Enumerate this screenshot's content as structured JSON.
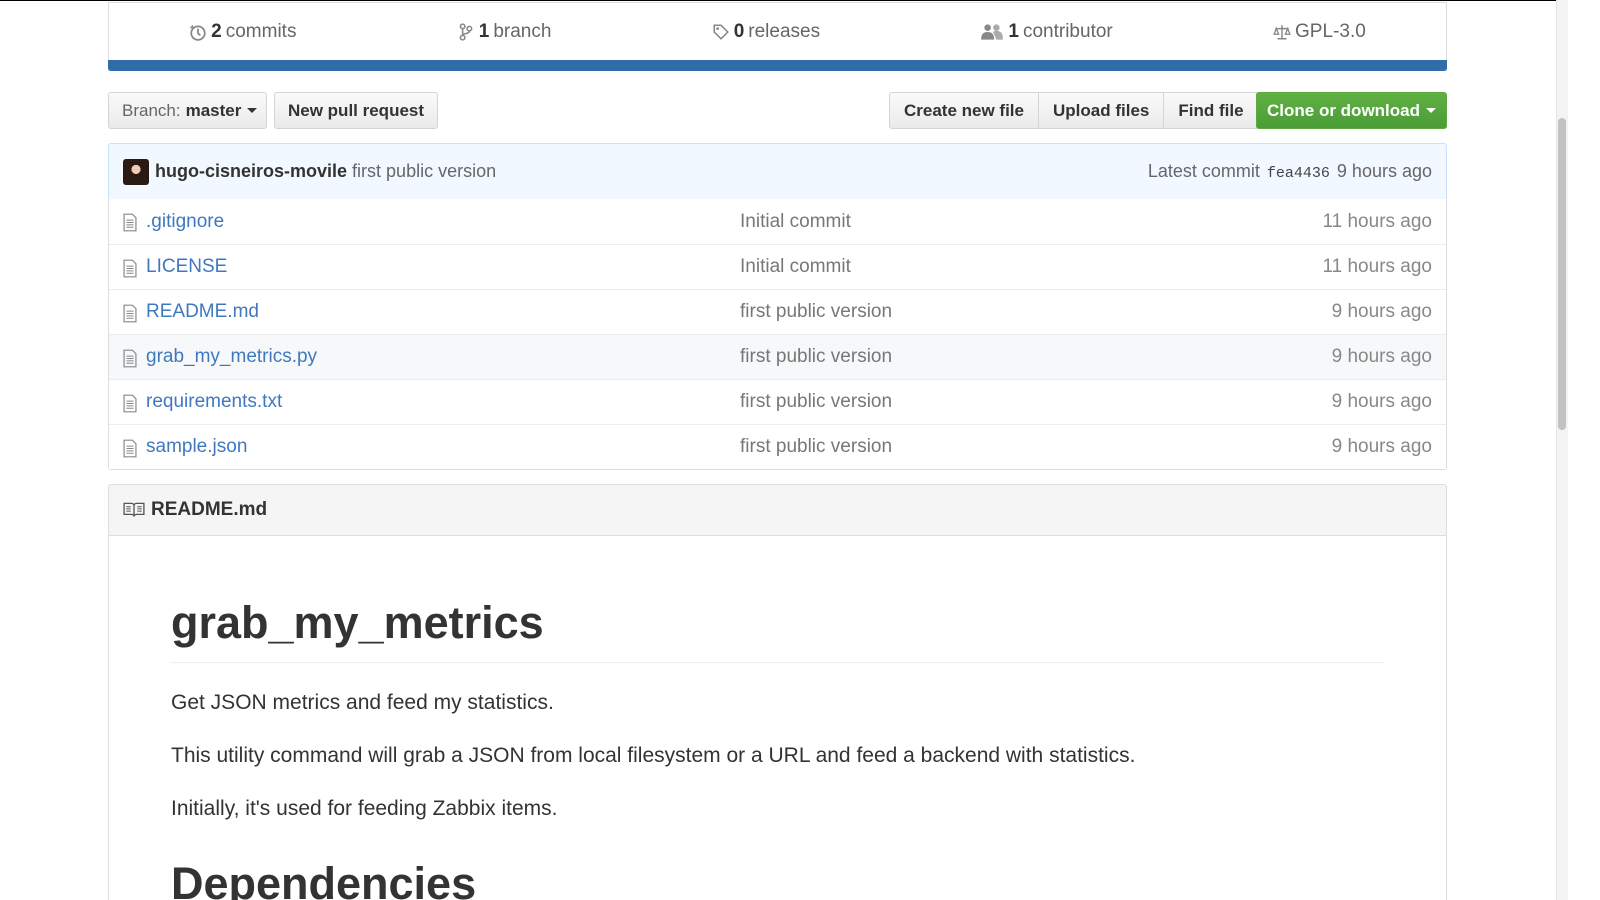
{
  "summary": {
    "commits": {
      "count": "2",
      "label": "commits"
    },
    "branches": {
      "count": "1",
      "label": "branch"
    },
    "releases": {
      "count": "0",
      "label": "releases"
    },
    "contributors": {
      "count": "1",
      "label": "contributor"
    },
    "license": "GPL-3.0"
  },
  "file_nav": {
    "branch_label": "Branch:",
    "branch_value": "master",
    "new_pull_request": "New pull request",
    "create_new_file": "Create new file",
    "upload_files": "Upload files",
    "find_file": "Find file",
    "clone_or_download": "Clone or download"
  },
  "commit_tease": {
    "author": "hugo-cisneiros-movile",
    "message": "first public version",
    "latest_label": "Latest commit",
    "sha": "fea4436",
    "age": "9 hours ago"
  },
  "files": [
    {
      "name": ".gitignore",
      "message": "Initial commit",
      "age": "11 hours ago"
    },
    {
      "name": "LICENSE",
      "message": "Initial commit",
      "age": "11 hours ago"
    },
    {
      "name": "README.md",
      "message": "first public version",
      "age": "9 hours ago"
    },
    {
      "name": "grab_my_metrics.py",
      "message": "first public version",
      "age": "9 hours ago"
    },
    {
      "name": "requirements.txt",
      "message": "first public version",
      "age": "9 hours ago"
    },
    {
      "name": "sample.json",
      "message": "first public version",
      "age": "9 hours ago"
    }
  ],
  "readme": {
    "header": "README.md",
    "h1": "grab_my_metrics",
    "paragraphs": [
      "Get JSON metrics and feed my statistics.",
      "This utility command will grab a JSON from local filesystem or a URL and feed a backend with statistics.",
      "Initially, it's used for feeding Zabbix items."
    ],
    "h2": "Dependencies"
  },
  "colors": {
    "link": "#4078c0",
    "summary_bar": "#2f6ca8",
    "clone_button": "#55a63c",
    "commit_tease_bg": "#f1f8ff"
  },
  "icons": [
    "history-icon",
    "branch-icon",
    "tag-icon",
    "people-icon",
    "law-icon",
    "file-icon",
    "book-icon"
  ]
}
